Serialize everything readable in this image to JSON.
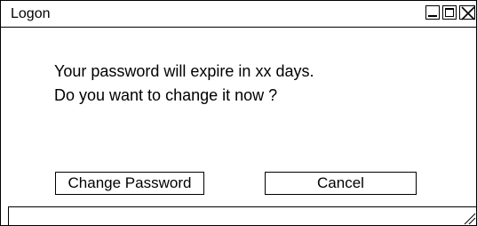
{
  "window": {
    "title": "Logon"
  },
  "title_buttons": {
    "minimize": "minimize-icon",
    "maximize": "maximize-icon",
    "close": "close-icon"
  },
  "message": {
    "line1": "Your password will expire in xx days.",
    "line2": "Do you want to change it now ?"
  },
  "buttons": {
    "change_password": "Change Password",
    "cancel": "Cancel"
  },
  "statusbar": {
    "grip_icon": "resize-grip-icon"
  }
}
